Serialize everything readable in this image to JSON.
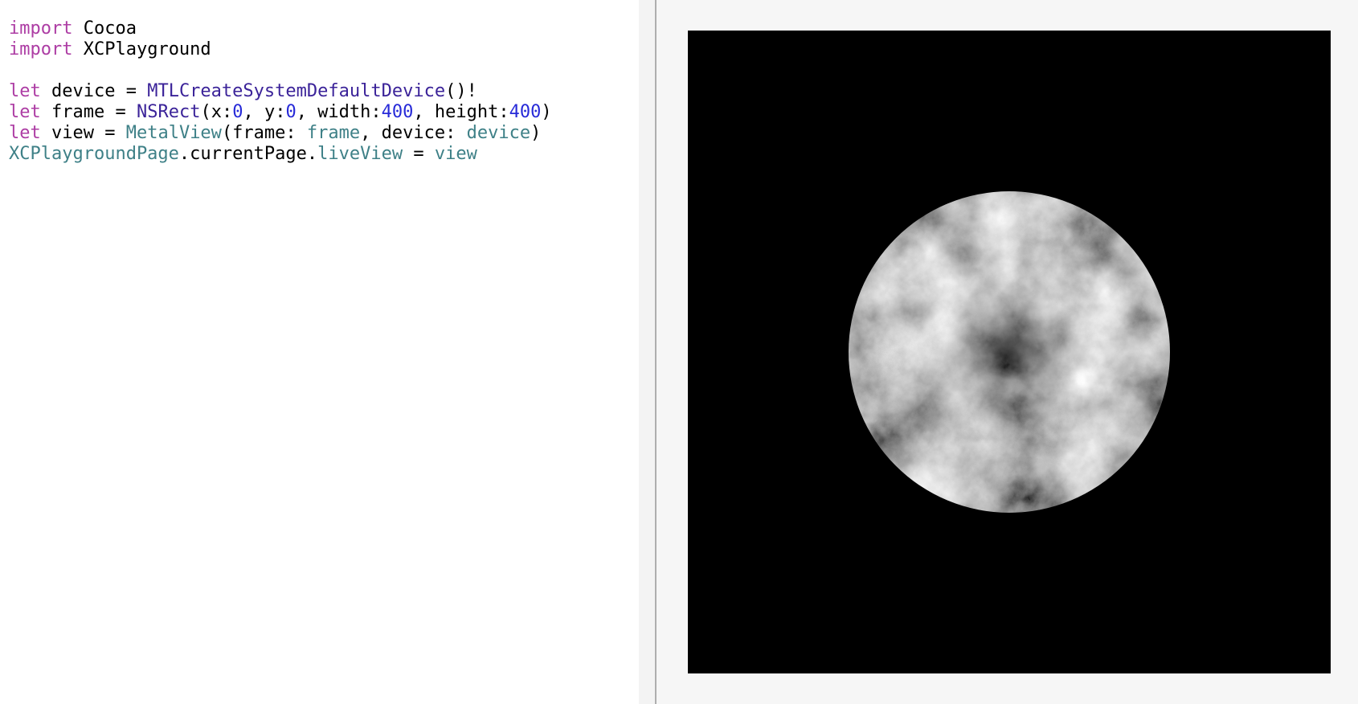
{
  "editor": {
    "lines": [
      [
        {
          "t": "import",
          "c": "kw"
        },
        {
          "t": " Cocoa",
          "c": "plain"
        }
      ],
      [
        {
          "t": "import",
          "c": "kw"
        },
        {
          "t": " XCPlayground",
          "c": "plain"
        }
      ],
      [],
      [
        {
          "t": "let",
          "c": "kw"
        },
        {
          "t": " device = ",
          "c": "plain"
        },
        {
          "t": "MTLCreateSystemDefaultDevice",
          "c": "fn"
        },
        {
          "t": "()!",
          "c": "plain"
        }
      ],
      [
        {
          "t": "let",
          "c": "kw"
        },
        {
          "t": " frame = ",
          "c": "plain"
        },
        {
          "t": "NSRect",
          "c": "type"
        },
        {
          "t": "(x:",
          "c": "plain"
        },
        {
          "t": "0",
          "c": "num"
        },
        {
          "t": ", y:",
          "c": "plain"
        },
        {
          "t": "0",
          "c": "num"
        },
        {
          "t": ", width:",
          "c": "plain"
        },
        {
          "t": "400",
          "c": "num"
        },
        {
          "t": ", height:",
          "c": "plain"
        },
        {
          "t": "400",
          "c": "num"
        },
        {
          "t": ")",
          "c": "plain"
        }
      ],
      [
        {
          "t": "let",
          "c": "kw"
        },
        {
          "t": " view = ",
          "c": "plain"
        },
        {
          "t": "MetalView",
          "c": "var"
        },
        {
          "t": "(frame: ",
          "c": "plain"
        },
        {
          "t": "frame",
          "c": "var"
        },
        {
          "t": ", device: ",
          "c": "plain"
        },
        {
          "t": "device",
          "c": "var"
        },
        {
          "t": ")",
          "c": "plain"
        }
      ],
      [
        {
          "t": "XCPlaygroundPage",
          "c": "var"
        },
        {
          "t": ".currentPage.",
          "c": "plain"
        },
        {
          "t": "liveView",
          "c": "var"
        },
        {
          "t": " = ",
          "c": "plain"
        },
        {
          "t": "view",
          "c": "var"
        }
      ]
    ]
  },
  "colors": {
    "keyword": "#ad3da4",
    "type": "#3b2399",
    "number": "#272ad8",
    "identifier": "#3e8087",
    "plain": "#000000",
    "live_view_background": "#000000",
    "panel_background": "#f6f6f6"
  },
  "live_view": {
    "content": "noise-sphere-render"
  }
}
